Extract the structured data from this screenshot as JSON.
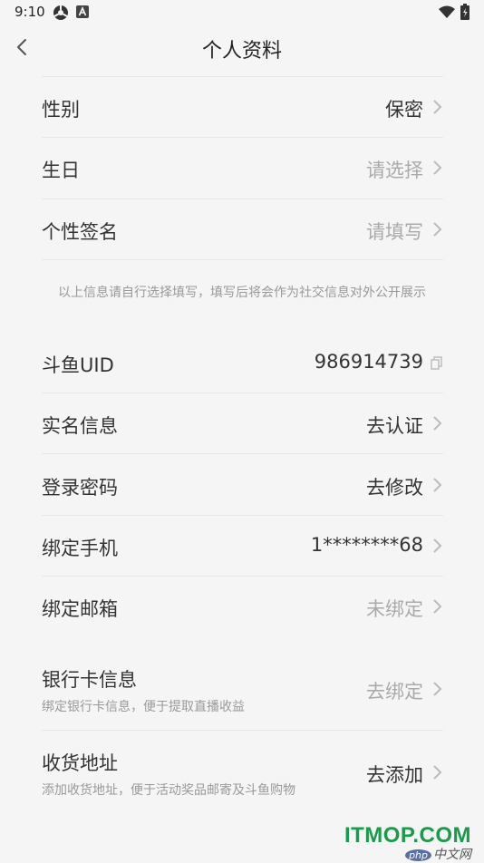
{
  "status_bar": {
    "time": "9:10"
  },
  "header": {
    "title": "个人资料"
  },
  "profile_rows": [
    {
      "label": "性别",
      "value": "保密"
    },
    {
      "label": "生日",
      "value": "请选择"
    },
    {
      "label": "个性签名",
      "value": "请填写"
    }
  ],
  "note": "以上信息请自行选择填写，填写后将会作为社交信息对外公开展示",
  "account_rows": [
    {
      "label": "斗鱼UID",
      "value": "986914739"
    },
    {
      "label": "实名信息",
      "value": "去认证"
    },
    {
      "label": "登录密码",
      "value": "去修改"
    },
    {
      "label": "绑定手机",
      "value": "1********68"
    },
    {
      "label": "绑定邮箱",
      "value": "未绑定"
    }
  ],
  "extra_rows": [
    {
      "label": "银行卡信息",
      "sublabel": "绑定银行卡信息，便于提取直播收益",
      "value": "去绑定"
    },
    {
      "label": "收货地址",
      "sublabel": "添加收货地址，便于活动奖品邮寄及斗鱼购物",
      "value": "去添加"
    }
  ],
  "watermark": {
    "text": "ITMOP.COM",
    "badge_php": "php",
    "badge_cn": "中文网"
  },
  "colors": {
    "background": "#f5f5f5",
    "text_dark": "#333333",
    "text_light": "#aaaaaa",
    "divider": "#e6e6e6",
    "watermark": "#1a9a4a"
  },
  "icons": [
    "back-arrow",
    "chevron-right",
    "copy",
    "wifi",
    "battery",
    "settings",
    "notification-a"
  ]
}
